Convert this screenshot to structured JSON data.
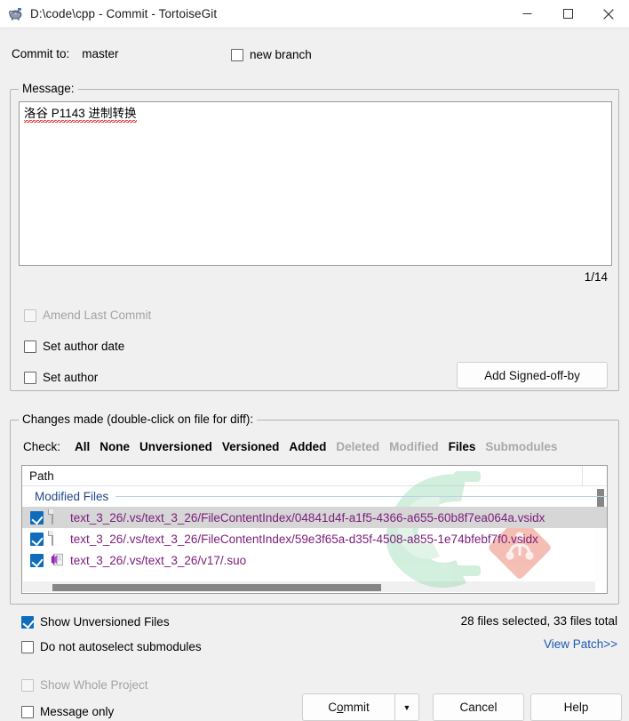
{
  "window": {
    "title": "D:\\code\\cpp - Commit - TortoiseGit",
    "icon": "tortoisegit-icon",
    "minimize_label": "—",
    "maximize_label": "☐",
    "close_label": "✕"
  },
  "commit_to": {
    "label": "Commit to:",
    "branch": "master",
    "new_branch_label": "new branch",
    "new_branch_checked": false
  },
  "message": {
    "group_label": "Message:",
    "text": "洛谷 P1143 进制转换",
    "counter": "1/14",
    "amend_label": "Amend Last Commit",
    "amend_checked": false,
    "amend_disabled": true,
    "set_author_date_label": "Set author date",
    "set_author_date_checked": false,
    "set_author_label": "Set author",
    "set_author_checked": false,
    "signoff_button": "Add Signed-off-by"
  },
  "changes": {
    "group_label": "Changes made (double-click on file for diff):",
    "check_label": "Check:",
    "check_links": [
      {
        "label": "All",
        "enabled": true
      },
      {
        "label": "None",
        "enabled": true
      },
      {
        "label": "Unversioned",
        "enabled": true
      },
      {
        "label": "Versioned",
        "enabled": true
      },
      {
        "label": "Added",
        "enabled": true
      },
      {
        "label": "Deleted",
        "enabled": false
      },
      {
        "label": "Modified",
        "enabled": false
      },
      {
        "label": "Files",
        "enabled": true
      },
      {
        "label": "Submodules",
        "enabled": false
      }
    ],
    "column_header": "Path",
    "group_header": "Modified Files",
    "rows": [
      {
        "path": "text_3_26/.vs/text_3_26/FileContentIndex/04841d4f-a1f5-4366-a655-60b8f7ea064a.vsidx",
        "checked": true,
        "selected": true,
        "icon": "document-icon"
      },
      {
        "path": "text_3_26/.vs/text_3_26/FileContentIndex/59e3f65a-d35f-4508-a855-1e74bfebf7f0.vsidx",
        "checked": true,
        "selected": false,
        "icon": "document-icon"
      },
      {
        "path": "text_3_26/.vs/text_3_26/v17/.suo",
        "checked": true,
        "selected": false,
        "icon": "visual-studio-suo-icon"
      }
    ]
  },
  "footer": {
    "show_unversioned_label": "Show Unversioned Files",
    "show_unversioned_checked": true,
    "no_autoselect_submodules_label": "Do not autoselect submodules",
    "no_autoselect_submodules_checked": false,
    "files_count": "28 files selected, 33 files total",
    "view_patch_label": "View Patch>>",
    "show_whole_project_label": "Show Whole Project",
    "show_whole_project_checked": false,
    "show_whole_project_disabled": true,
    "message_only_label": "Message only",
    "message_only_checked": false,
    "commit_label_pre": "C",
    "commit_label_mnemonic": "o",
    "commit_label_post": "mmit",
    "commit_dropdown_glyph": "▼",
    "cancel_label": "Cancel",
    "help_label": "Help"
  },
  "colors": {
    "accent": "#0f6cbd",
    "link": "#1b59b3",
    "group_header_text": "#21498a",
    "file_path_text": "#7b1d7b",
    "spellcheck_underline": "#e01b1b",
    "window_bg": "#f0f0f0",
    "titlebar_bg": "#ffffff",
    "selection_bg": "#d6d6d6",
    "disabled_text": "#a9a9a9"
  }
}
